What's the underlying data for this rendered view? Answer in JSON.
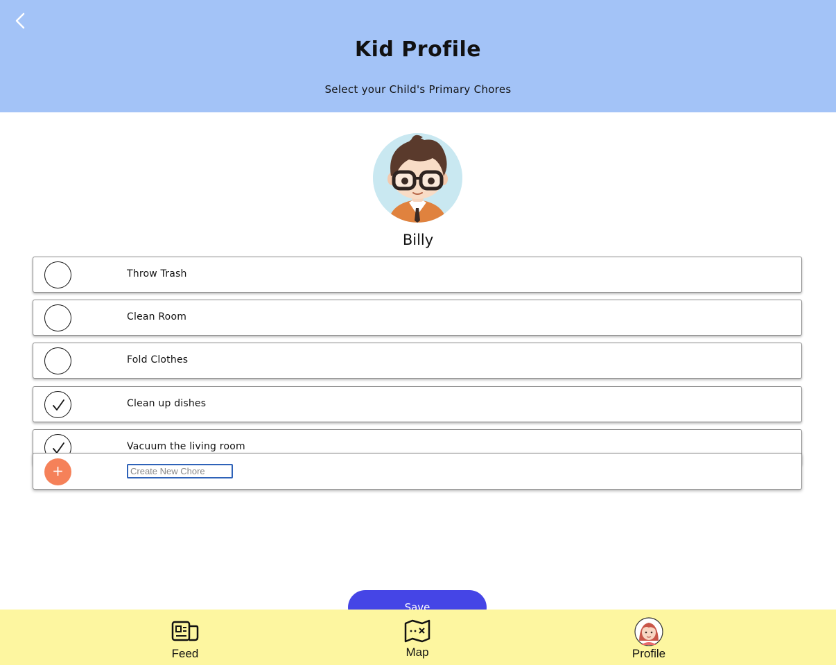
{
  "header": {
    "title": "Kid Profile",
    "subtitle": "Select your Child's Primary Chores",
    "back_icon": "chevron-left-icon"
  },
  "kid": {
    "name": "Billy",
    "avatar_icon": "boy-with-glasses-avatar"
  },
  "chores": [
    {
      "label": "Throw Trash",
      "checked": false
    },
    {
      "label": "Clean Room",
      "checked": false
    },
    {
      "label": "Fold Clothes",
      "checked": false
    },
    {
      "label": "Clean up dishes",
      "checked": true
    },
    {
      "label": "Vacuum the living room",
      "checked": true
    }
  ],
  "new_chore": {
    "add_label": "+",
    "value": "",
    "placeholder": "Create New Chore"
  },
  "actions": {
    "save_label": "Save"
  },
  "nav": {
    "feed_label": "Feed",
    "map_label": "Map",
    "profile_label": "Profile"
  },
  "colors": {
    "header_bg": "#a3c3f7",
    "nav_bg": "#fdf6a0",
    "save_bg": "#4545e6",
    "add_bg": "#f58159"
  }
}
